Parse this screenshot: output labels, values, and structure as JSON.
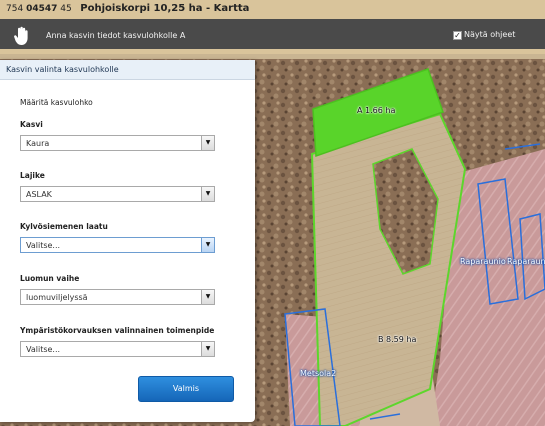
{
  "titlebar": {
    "number_prefix": "754",
    "number_bold": "04547",
    "number_suffix": "45",
    "title": "Pohjoiskorpi 10,25 ha - Kartta"
  },
  "toolbar": {
    "instruction": "Anna kasvin tiedot kasvulohkolle A",
    "show_help_label": "Näytä ohjeet",
    "show_help_checked": true,
    "checkmark": "✓"
  },
  "map": {
    "parcels": [
      {
        "label": "A 1.66 ha",
        "color": "#5dd62c"
      },
      {
        "label": "B 8.59 ha",
        "color": "#5dd62c"
      }
    ],
    "neighbours": [
      {
        "label": "Raparaunio"
      },
      {
        "label": "Raparaunio"
      },
      {
        "label": "Metsola2"
      }
    ],
    "border_color": "#2a6fdb"
  },
  "panel": {
    "title": "Kasvin valinta kasvulohkolle",
    "section": "Määritä kasvulohko",
    "fields": [
      {
        "label": "Kasvi",
        "value": "Kaura"
      },
      {
        "label": "Lajike",
        "value": "ASLAK"
      },
      {
        "label": "Kylvösiemenen laatu",
        "value": "Valitse..."
      },
      {
        "label": "Luomun vaihe",
        "value": "luomuviljelyssä"
      },
      {
        "label": "Ympäristökorvauksen valinnainen toimenpide",
        "value": "Valitse..."
      }
    ],
    "submit_label": "Valmis",
    "dropdown_arrow": "▼"
  }
}
